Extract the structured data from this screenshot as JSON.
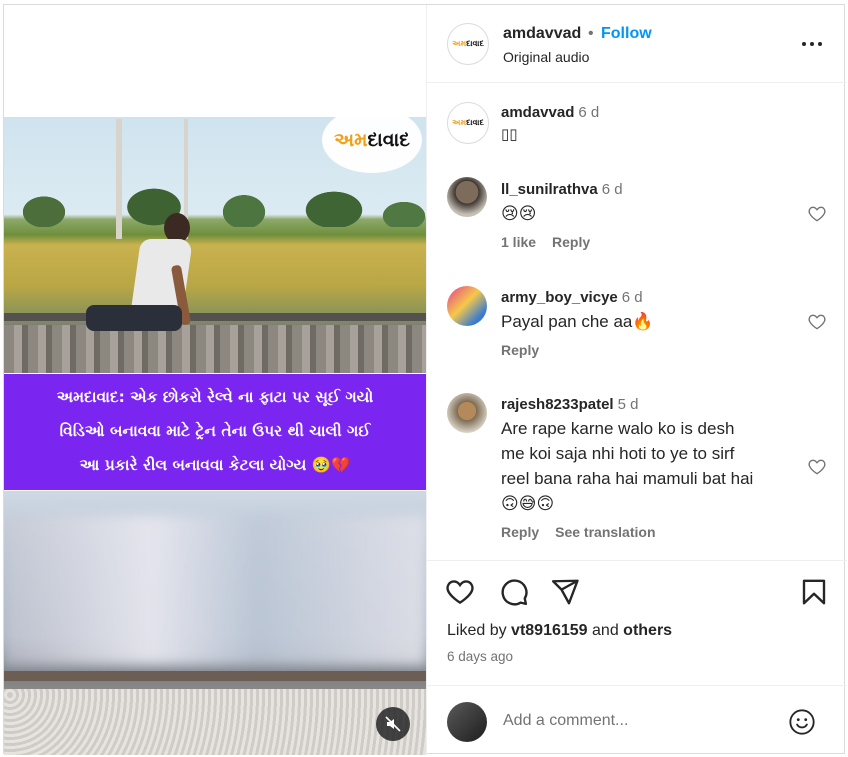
{
  "media": {
    "logo": {
      "part1": "અમ",
      "part2": "દાવાદ"
    },
    "caption_lines": [
      "અમદાવાદ: એક છોકરો રેલ્વે ના ફાટા પર સૂઈ ગયો",
      "વિડિઓ બનાવવા માટે ટ્રેન તેના ઉપર થી ચાલી ગઈ",
      "આ પ્રકારે રીલ બનાવવા કેટલા યોગ્ય 🥹💔"
    ],
    "mute_icon": "speaker-muted-icon"
  },
  "header": {
    "username": "amdavvad",
    "separator": "•",
    "follow_label": "Follow",
    "audio_label": "Original audio",
    "more_icon": "more-options-icon"
  },
  "caption_comment": {
    "username": "amdavvad",
    "time": "6 d",
    "text": "▯▯"
  },
  "comments": [
    {
      "username": "ll_sunilrathva",
      "time": "6 d",
      "text": "😢😢",
      "meta": [
        "1 like",
        "Reply"
      ]
    },
    {
      "username": "army_boy_vicye",
      "time": "6 d",
      "text": "Payal pan che aa🔥",
      "meta": [
        "Reply"
      ]
    },
    {
      "username": "rajesh8233patel",
      "time": "5 d",
      "text_lines": [
        "Are rape karne walo ko is desh",
        "me koi saja nhi hoti to ye to sirf",
        "reel bana raha hai mamuli bat hai"
      ],
      "emoji_line": "🙃😅🙃",
      "meta": [
        "Reply",
        "See translation"
      ]
    }
  ],
  "actions": {
    "icons": [
      "heart-icon",
      "comment-icon",
      "share-icon",
      "bookmark-icon"
    ],
    "liked_by_prefix": "Liked by",
    "liked_by_user": "vt8916159",
    "liked_by_and": "and",
    "liked_by_others": "others",
    "time_ago": "6 days ago"
  },
  "add_comment": {
    "placeholder": "Add a comment...",
    "emoji_icon": "smiley-icon"
  },
  "colors": {
    "follow_blue": "#0095f6",
    "caption_purple": "#7b25f0",
    "logo_orange": "#f2a11a",
    "secondary_text": "#737373"
  }
}
